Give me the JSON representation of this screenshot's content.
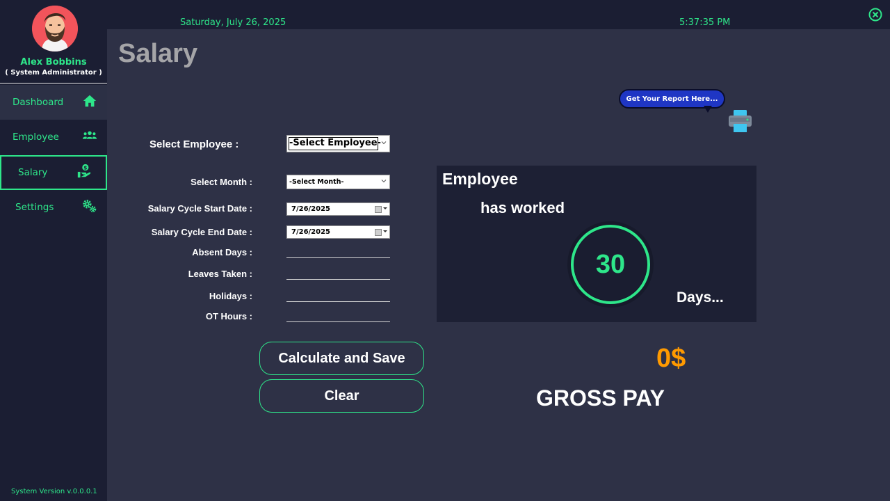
{
  "user": {
    "name": "Alex Bobbins",
    "role": "( System Administrator )"
  },
  "nav": [
    {
      "label": "Dashboard",
      "icon": "home-icon"
    },
    {
      "label": "Employee",
      "icon": "users-icon"
    },
    {
      "label": "Salary",
      "icon": "salary-hand-icon"
    },
    {
      "label": "Settings",
      "icon": "gears-icon"
    }
  ],
  "header": {
    "date": "Saturday, July 26, 2025",
    "time": "5:37:35 PM"
  },
  "page_title": "Salary",
  "report": {
    "label": "Get Your Report Here..."
  },
  "form": {
    "employee_label": "Select Employee :",
    "employee_value": "-Select Employee-",
    "month_label": "Select Month :",
    "month_value": "-Select Month-",
    "start_label": "Salary Cycle Start Date :",
    "start_value": "7/26/2025",
    "end_label": "Salary Cycle End Date :",
    "end_value": "7/26/2025",
    "absent_label": "Absent Days :",
    "absent_value": "",
    "leaves_label": "Leaves Taken :",
    "leaves_value": "",
    "holidays_label": "Holidays :",
    "holidays_value": "",
    "ot_label": "OT Hours :",
    "ot_value": ""
  },
  "buttons": {
    "calculate": "Calculate and Save",
    "clear": "Clear"
  },
  "panel": {
    "title": "Employee",
    "worked": "has worked",
    "days_count": "30",
    "days_label": "Days..."
  },
  "gross": {
    "amount": "0$",
    "label": "GROSS PAY"
  },
  "version": "System Version v.0.0.0.1",
  "colors": {
    "accent": "#2ee68a",
    "background": "#1b1e33",
    "content": "#2e3146",
    "amount": "#ff9a00",
    "report_bubble": "#1f36c4"
  }
}
